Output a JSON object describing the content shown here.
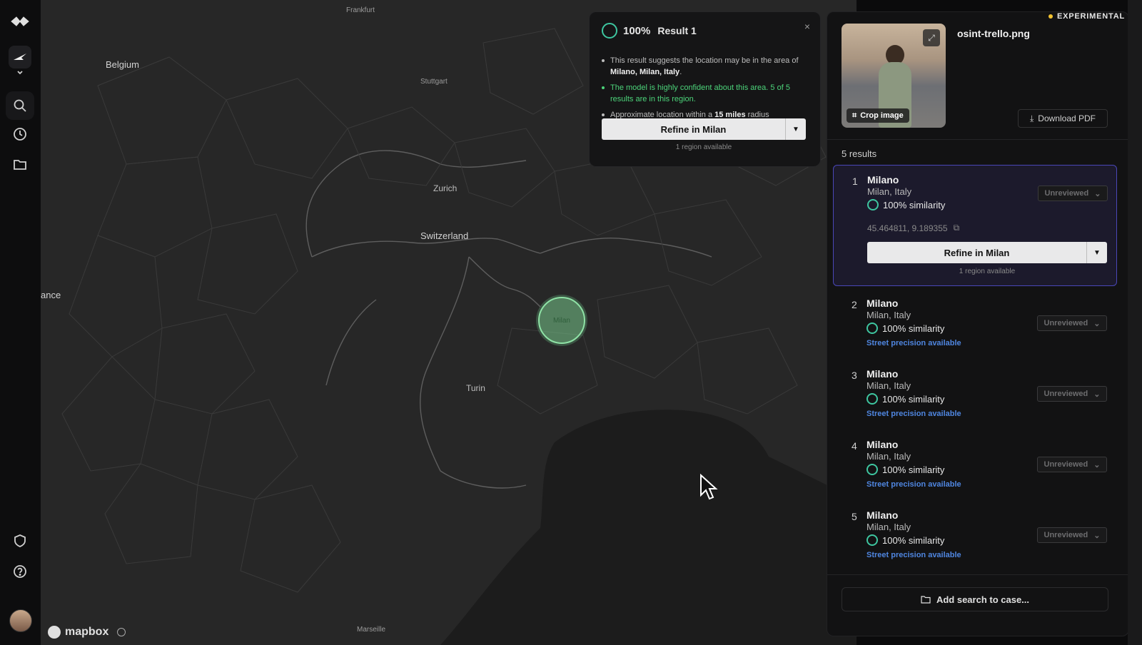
{
  "map": {
    "labels": {
      "frankfurt": "Frankfurt",
      "belgium": "Belgium",
      "stuttgart": "Stuttgart",
      "zurich": "Zurich",
      "switzerland": "Switzerland",
      "france": "ance",
      "turin": "Turin",
      "marseille": "Marseille",
      "milan_marker": "Milan"
    },
    "attribution": "mapbox"
  },
  "popup": {
    "percent": "100%",
    "title": "Result 1",
    "close": "×",
    "bullet1_pre": "This result suggests the location may be in the area of ",
    "bullet1_bold": "Milano, Milan, Italy",
    "bullet1_post": ".",
    "bullet2": "The model is highly confident about this area. 5 of 5 results are in this region.",
    "bullet3_pre": "Approximate location within a ",
    "bullet3_bold": "15 miles",
    "bullet3_post": " radius",
    "refine_label": "Refine in Milan",
    "region_note": "1 region available"
  },
  "panel": {
    "experimental": "EXPERIMENTAL",
    "filename": "osint-trello.png",
    "crop_label": "Crop image",
    "download_label": "Download PDF",
    "results_count": "5 results",
    "add_case_label": "Add search to case...",
    "results": [
      {
        "num": "1",
        "title": "Milano",
        "loc": "Milan, Italy",
        "sim": "100% similarity",
        "status": "Unreviewed",
        "coords": "45.464811, 9.189355",
        "refine": "Refine in Milan",
        "region_note": "1 region available"
      },
      {
        "num": "2",
        "title": "Milano",
        "loc": "Milan, Italy",
        "sim": "100% similarity",
        "status": "Unreviewed",
        "street": "Street precision available"
      },
      {
        "num": "3",
        "title": "Milano",
        "loc": "Milan, Italy",
        "sim": "100% similarity",
        "status": "Unreviewed",
        "street": "Street precision available"
      },
      {
        "num": "4",
        "title": "Milano",
        "loc": "Milan, Italy",
        "sim": "100% similarity",
        "status": "Unreviewed",
        "street": "Street precision available"
      },
      {
        "num": "5",
        "title": "Milano",
        "loc": "Milan, Italy",
        "sim": "100% similarity",
        "status": "Unreviewed",
        "street": "Street precision available"
      }
    ]
  },
  "colors": {
    "accent_ring": "#3ec6a0",
    "active_border": "#4a47b8",
    "confidence_green": "#4cd47a",
    "street_link": "#4f86e0",
    "experimental_dot": "#f2c230"
  }
}
